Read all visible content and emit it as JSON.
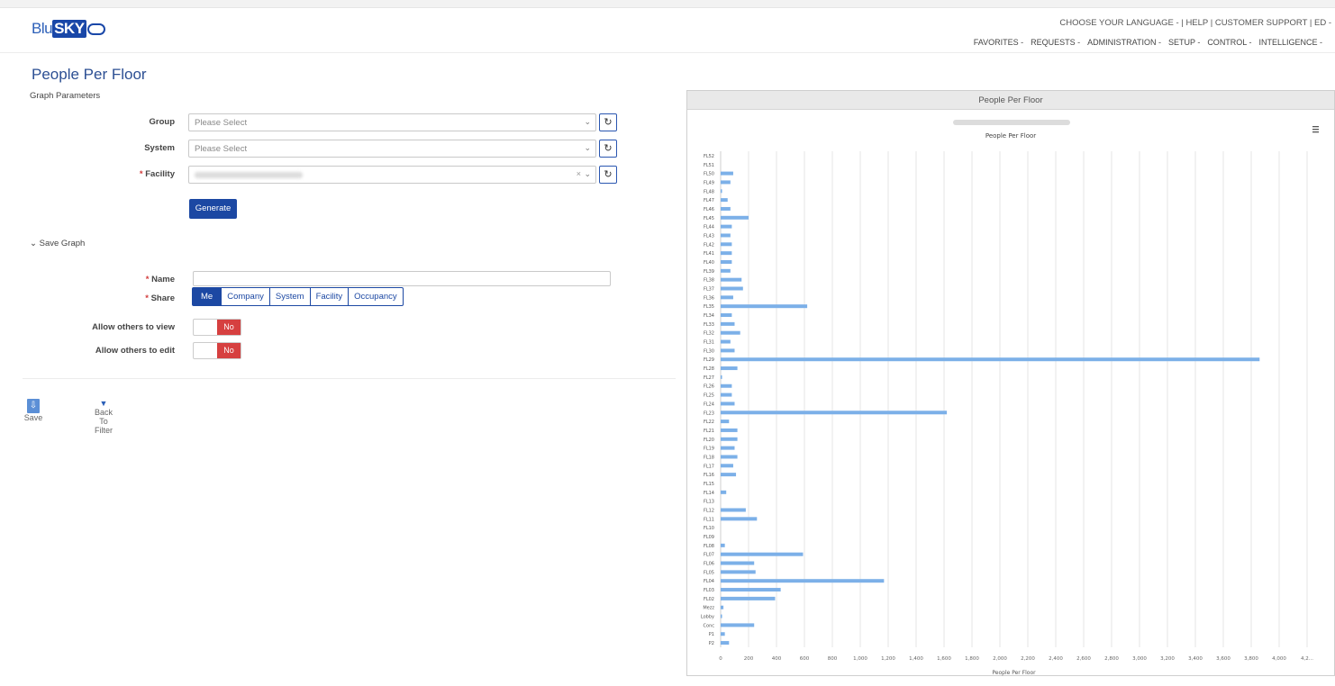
{
  "brand": {
    "prefix": "Blu",
    "highlight": "SKY"
  },
  "utility_nav": "CHOOSE YOUR LANGUAGE - | HELP | CUSTOMER SUPPORT | ED -",
  "main_nav": [
    "FAVORITES -",
    "REQUESTS -",
    "ADMINISTRATION -",
    "SETUP -",
    "CONTROL -",
    "INTELLIGENCE -"
  ],
  "page_title": "People Per Floor",
  "graph_params": {
    "section_label": "Graph Parameters",
    "group_label": "Group",
    "group_placeholder": "Please Select",
    "system_label": "System",
    "system_placeholder": "Please Select",
    "facility_label": "Facility",
    "facility_clear": "×",
    "generate_label": "Generate"
  },
  "save_graph": {
    "section_label": "Save Graph",
    "name_label": "Name",
    "name_value": "",
    "share_label": "Share",
    "share_options": [
      "Me",
      "Company",
      "System",
      "Facility",
      "Occupancy"
    ],
    "share_selected": "Me",
    "allow_view_label": "Allow others to view",
    "allow_view_value": "No",
    "allow_edit_label": "Allow others to edit",
    "allow_edit_value": "No"
  },
  "actions": {
    "save": "Save",
    "back": "Back To Filter"
  },
  "icons": {
    "refresh": "refresh-icon",
    "caret": "chevron-down-icon",
    "menu": "hamburger-menu-icon",
    "save": "save-icon",
    "filter": "filter-icon"
  },
  "colors": {
    "brand": "#1c48a3",
    "bar": "#7cb0e8",
    "toggle_no": "#d64040"
  },
  "chart_data": {
    "type": "bar",
    "orientation": "horizontal",
    "header": "People Per Floor",
    "subtitle": "People Per Floor",
    "xlabel": "People Per Floor",
    "xlim": [
      0,
      4200
    ],
    "xticks": [
      "0",
      "200",
      "400",
      "600",
      "800",
      "1,000",
      "1,200",
      "1,400",
      "1,600",
      "1,800",
      "2,000",
      "2,200",
      "2,400",
      "2,600",
      "2,800",
      "3,000",
      "3,200",
      "3,400",
      "3,600",
      "3,800",
      "4,000",
      "4,2..."
    ],
    "grid": true,
    "categories": [
      "FL52",
      "FL51",
      "FL50",
      "FL49",
      "FL48",
      "FL47",
      "FL46",
      "FL45",
      "FL44",
      "FL43",
      "FL42",
      "FL41",
      "FL40",
      "FL39",
      "FL38",
      "FL37",
      "FL36",
      "FL35",
      "FL34",
      "FL33",
      "FL32",
      "FL31",
      "FL30",
      "FL29",
      "FL28",
      "FL27",
      "FL26",
      "FL25",
      "FL24",
      "FL23",
      "FL22",
      "FL21",
      "FL20",
      "FL19",
      "FL18",
      "FL17",
      "FL16",
      "FL15",
      "FL14",
      "FL13",
      "FL12",
      "FL11",
      "FL10",
      "FL09",
      "FL08",
      "FL07",
      "FL06",
      "FL05",
      "FL04",
      "FL03",
      "FL02",
      "Mezz",
      "Lobby",
      "Conc",
      "P1",
      "P2"
    ],
    "values": [
      0,
      0,
      90,
      70,
      10,
      50,
      70,
      200,
      80,
      70,
      80,
      80,
      80,
      70,
      150,
      160,
      90,
      620,
      80,
      100,
      140,
      70,
      100,
      3860,
      120,
      10,
      80,
      80,
      100,
      1620,
      60,
      120,
      120,
      100,
      120,
      90,
      110,
      0,
      40,
      0,
      180,
      260,
      0,
      0,
      30,
      590,
      240,
      250,
      1170,
      430,
      390,
      20,
      10,
      240,
      30,
      60
    ]
  }
}
